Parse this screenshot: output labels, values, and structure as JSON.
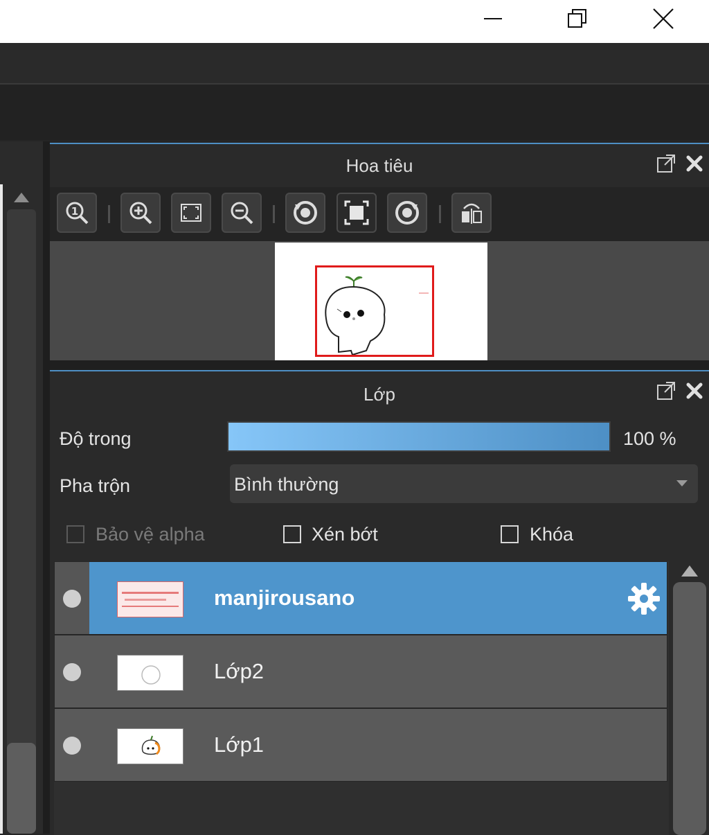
{
  "window": {
    "controls": [
      {
        "name": "minimize",
        "icon": "minimize-icon"
      },
      {
        "name": "restore",
        "icon": "restore-icon"
      },
      {
        "name": "close",
        "icon": "close-icon"
      }
    ]
  },
  "navigator": {
    "title": "Hoa tiêu",
    "toolbar": [
      "zoom-actual-icon",
      "zoom-in-icon",
      "fit-view-icon",
      "zoom-out-icon",
      "rotate-left-icon",
      "fit-canvas-icon",
      "rotate-right-icon",
      "flip-horizontal-icon"
    ]
  },
  "layers": {
    "title": "Lớp",
    "opacity_label": "Độ trong",
    "opacity_value": "100 %",
    "opacity_fraction": 1.0,
    "blend_label": "Pha trộn",
    "blend_value": "Bình thường",
    "protect_alpha_label": "Bảo vệ alpha",
    "clip_label": "Xén bớt",
    "lock_label": "Khóa",
    "items": [
      {
        "name": "manjirousano",
        "selected": true
      },
      {
        "name": "Lớp2",
        "selected": false
      },
      {
        "name": "Lớp1",
        "selected": false
      }
    ]
  },
  "colors": {
    "accent": "#4e95cc",
    "selection_rect": "#e01b1b"
  }
}
